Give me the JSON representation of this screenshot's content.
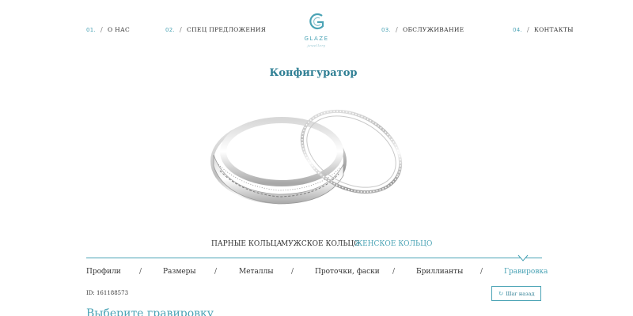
{
  "nav": {
    "items": [
      {
        "num": "01.",
        "label": "О НАС"
      },
      {
        "num": "02.",
        "label": "СПЕЦ ПРЕДЛОЖЕНИЯ"
      },
      {
        "num": "03.",
        "label": "ОБСЛУЖИВАНИЕ"
      },
      {
        "num": "04.",
        "label": "КОНТАКТЫ"
      }
    ],
    "separator": "/"
  },
  "logo": {
    "text": "GLAZE",
    "subtext": "jewellery"
  },
  "title": "Конфигуратор",
  "ring_tabs": [
    {
      "label": "ПАРНЫЕ КОЛЬЦА"
    },
    {
      "label": "МУЖСКОЕ КОЛЬЦО"
    },
    {
      "label": "ЖЕНСКОЕ КОЛЬЦО",
      "active": true
    }
  ],
  "steps": [
    {
      "label": "Профили"
    },
    {
      "label": "Размеры"
    },
    {
      "label": "Металлы"
    },
    {
      "label": "Проточки, фаски"
    },
    {
      "label": "Бриллианты"
    },
    {
      "label": "Гравировка",
      "active": true
    }
  ],
  "step_separator": "/",
  "config_id": "ID: 161188573",
  "back_button": {
    "icon": "refresh-icon",
    "label": "Шаг назад"
  },
  "section_title": "Выберите гравировку",
  "colors": {
    "accent": "#4aa3b5",
    "accent_dark": "#2f7f94",
    "text": "#333333"
  }
}
